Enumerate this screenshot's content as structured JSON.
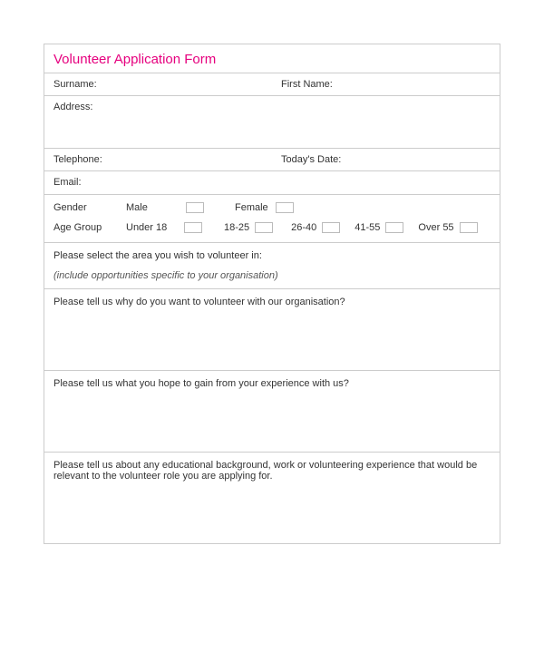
{
  "form": {
    "title": "Volunteer Application Form",
    "fields": {
      "surname": "Surname:",
      "firstName": "First Name:",
      "address": "Address:",
      "telephone": "Telephone:",
      "todaysDate": "Today's Date:",
      "email": "Email:"
    },
    "gender": {
      "label": "Gender",
      "options": {
        "male": "Male",
        "female": "Female"
      }
    },
    "ageGroup": {
      "label": "Age Group",
      "options": {
        "under18": "Under 18",
        "r18_25": "18-25",
        "r26_40": "26-40",
        "r41_55": "41-55",
        "over55": "Over 55"
      }
    },
    "areaSelect": {
      "prompt": "Please select the area you wish to volunteer in:",
      "note": "(include opportunities specific to your organisation)"
    },
    "q_why": "Please tell us why do you want to volunteer with our organisation?",
    "q_gain": "Please tell us what you hope to gain from your experience with us?",
    "q_background": "Please tell us about any educational background, work or volunteering experience that would be relevant to the volunteer role you are applying for."
  }
}
